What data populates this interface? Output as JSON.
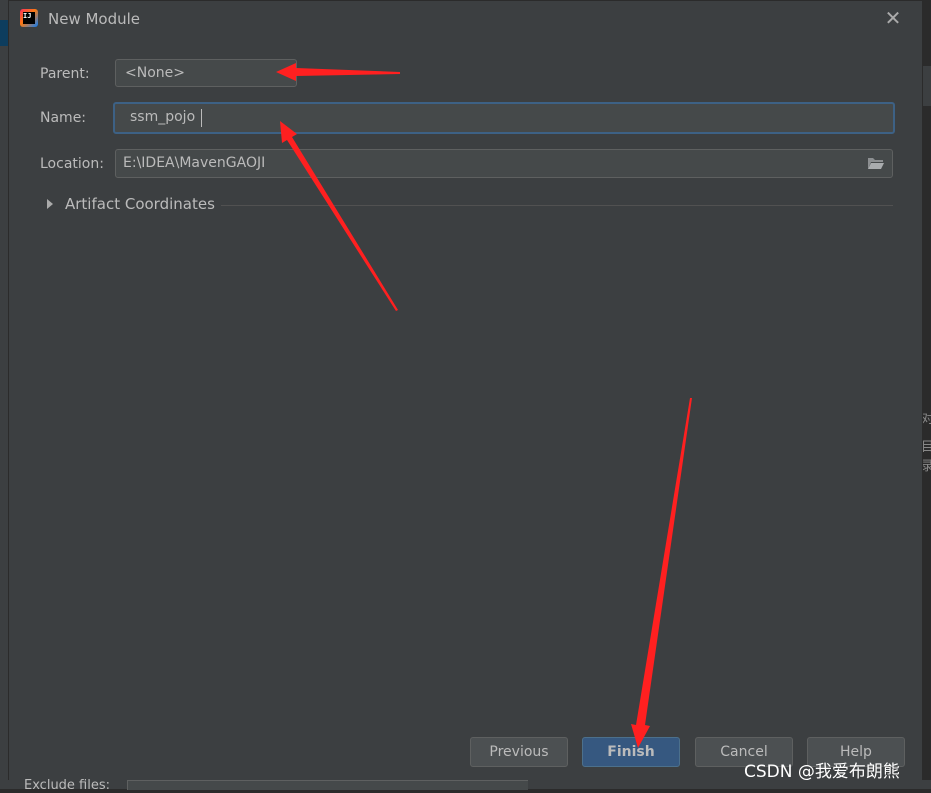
{
  "dialog": {
    "title": "New Module",
    "app_icon_text": "IJ"
  },
  "form": {
    "parent_label": "Parent:",
    "parent_value": "<None>",
    "name_label": "Name:",
    "name_value": "ssm_pojo",
    "location_label": "Location:",
    "location_value": "E:\\IDEA\\MavenGAOJI",
    "artifact_label": "Artifact Coordinates"
  },
  "buttons": {
    "previous": "Previous",
    "finish": "Finish",
    "cancel": "Cancel",
    "help": "Help"
  },
  "background": {
    "exclude_label": "Exclude files:",
    "right_glyph_1": "对",
    "right_glyph_2": "目录"
  },
  "watermark": "CSDN @我爱布朗熊",
  "colors": {
    "accent": "#365880",
    "annotation_arrow": "#ff2020"
  }
}
